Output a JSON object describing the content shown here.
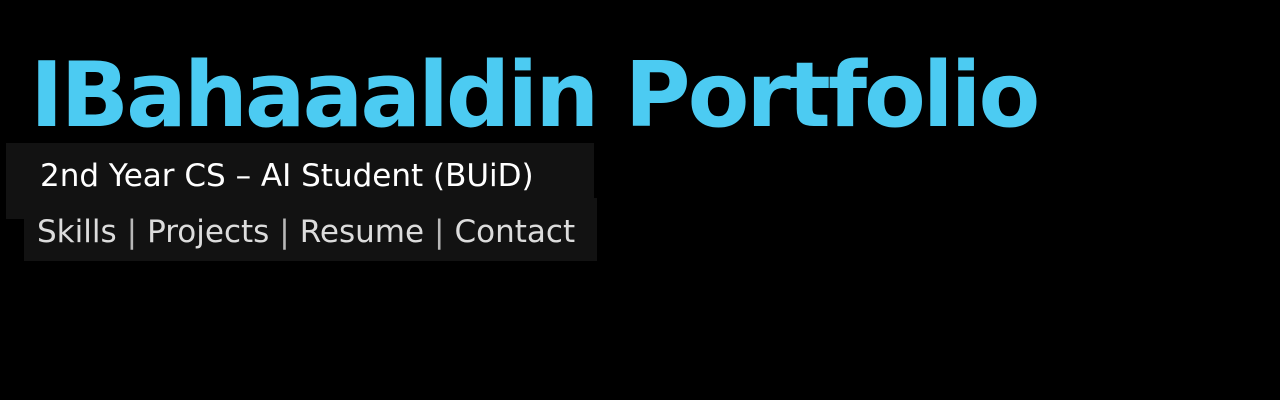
{
  "header": {
    "title": "IBahaaaldin Portfolio",
    "subtitle": "2nd Year CS – AI Student (BUiD)"
  },
  "nav": {
    "separator": "|",
    "items": [
      {
        "label": "Skills"
      },
      {
        "label": "Projects"
      },
      {
        "label": "Resume"
      },
      {
        "label": "Contact"
      }
    ]
  },
  "colors": {
    "background": "#000000",
    "accent": "#4ccbf2",
    "panel": "#121212",
    "text": "#ffffff"
  }
}
